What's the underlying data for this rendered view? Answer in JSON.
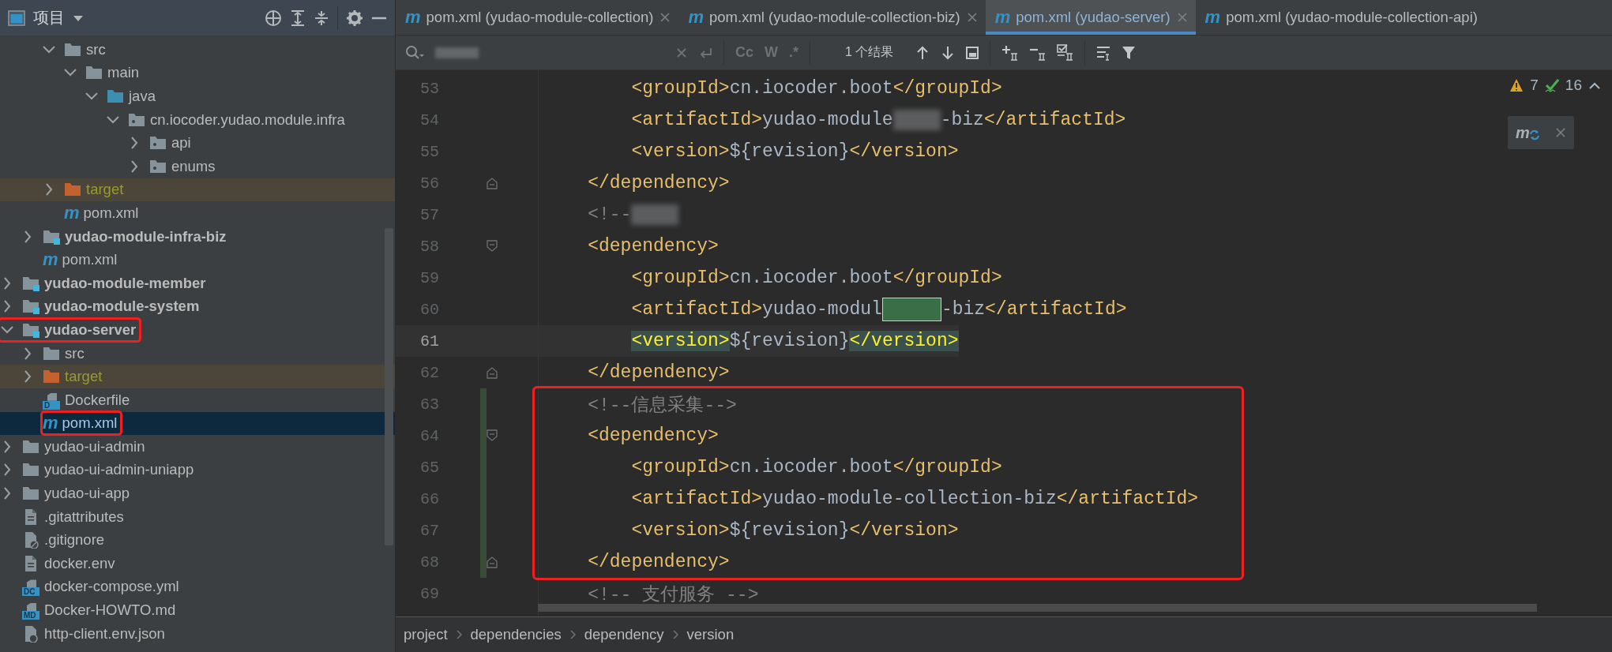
{
  "project_panel": {
    "title": "项目",
    "tree": [
      {
        "children": [
          {
            "children": [
              {
                "label": "src",
                "kind": "folder",
                "expanded": true,
                "selected": false,
                "children": [
                  {
                    "label": "main",
                    "kind": "folder",
                    "expanded": true,
                    "selected": false,
                    "children": [
                      {
                        "label": "java",
                        "kind": "source-folder",
                        "expanded": true,
                        "selected": false,
                        "children": [
                          {
                            "label": "cn.iocoder.yudao.module.infra",
                            "kind": "package",
                            "expanded": true,
                            "selected": false,
                            "children": [
                              {
                                "label": "api",
                                "kind": "package",
                                "expanded": false,
                                "selected": false
                              },
                              {
                                "label": "enums",
                                "kind": "package",
                                "expanded": false,
                                "selected": false
                              }
                            ]
                          }
                        ]
                      }
                    ]
                  }
                ]
              },
              {
                "label": "target",
                "kind": "excluded-folder",
                "expanded": false,
                "selected": false
              },
              {
                "label": "pom.xml",
                "kind": "maven",
                "badge": "m",
                "selected": false
              }
            ]
          },
          {
            "label": "yudao-module-infra-biz",
            "kind": "module",
            "expanded": false,
            "selected": false
          },
          {
            "label": "pom.xml",
            "kind": "maven",
            "badge": "m",
            "selected": false
          }
        ]
      },
      {
        "label": "yudao-module-member",
        "kind": "module",
        "expanded": false,
        "selected": false
      },
      {
        "label": "yudao-module-system",
        "kind": "module",
        "expanded": false,
        "selected": false
      },
      {
        "label": "yudao-server",
        "kind": "module",
        "expanded": true,
        "selected": false,
        "annotated": true,
        "children": [
          {
            "label": "src",
            "kind": "folder",
            "expanded": false,
            "selected": false
          },
          {
            "label": "target",
            "kind": "excluded-folder",
            "expanded": false,
            "selected": false
          },
          {
            "label": "Dockerfile",
            "kind": "badged-file",
            "badge": "D",
            "selected": false
          },
          {
            "label": "pom.xml",
            "kind": "maven",
            "badge": "m",
            "selected": true,
            "annotated": true
          }
        ]
      },
      {
        "label": "yudao-ui-admin",
        "kind": "folder",
        "expanded": false,
        "selected": false
      },
      {
        "label": "yudao-ui-admin-uniapp",
        "kind": "folder",
        "expanded": false,
        "selected": false
      },
      {
        "label": "yudao-ui-app",
        "kind": "folder",
        "expanded": false,
        "selected": false
      },
      {
        "label": ".gitattributes",
        "kind": "text-file",
        "selected": false
      },
      {
        "label": ".gitignore",
        "kind": "ignore-file",
        "selected": false
      },
      {
        "label": "docker.env",
        "kind": "text-file",
        "selected": false
      },
      {
        "label": "docker-compose.yml",
        "kind": "badged-file",
        "badge": "DC",
        "selected": false
      },
      {
        "label": "Docker-HOWTO.md",
        "kind": "badged-file",
        "badge": "MD",
        "selected": false
      },
      {
        "label": "http-client.env.json",
        "kind": "json-file",
        "selected": false
      }
    ]
  },
  "tabs": [
    {
      "badge": "m",
      "label": "pom.xml (yudao-module-collection)",
      "selected": false,
      "closable": true
    },
    {
      "badge": "m",
      "label": "pom.xml (yudao-module-collection-biz)",
      "selected": false,
      "closable": true
    },
    {
      "badge": "m",
      "label": "pom.xml (yudao-server)",
      "selected": true,
      "closable": true
    },
    {
      "badge": "m",
      "label": "pom.xml (yudao-module-collection-api)",
      "selected": false,
      "closable": false
    }
  ],
  "find_bar": {
    "options": [
      "Cc",
      "W",
      ".*"
    ],
    "result": "1 个结果"
  },
  "inspections": {
    "warnings": "7",
    "weak_warnings": "16"
  },
  "maven_popup": {
    "badge": "m"
  },
  "code_lines": [
    {
      "number": "53",
      "kind": "plain",
      "changed": false,
      "current": false,
      "annotated": false,
      "tokens": [
        {
          "kind": "tag",
          "text": "        <groupId>"
        },
        {
          "kind": "text",
          "text": "cn.iocoder.boot"
        },
        {
          "kind": "tag",
          "text": "</groupId>"
        }
      ]
    },
    {
      "number": "54",
      "kind": "plain",
      "changed": false,
      "current": false,
      "annotated": false,
      "tokens": [
        {
          "kind": "tag",
          "text": "        <artifactId>"
        },
        {
          "kind": "text",
          "text": "yudao-module"
        },
        {
          "kind": "redacted"
        },
        {
          "kind": "text",
          "text": "-biz"
        },
        {
          "kind": "tag",
          "text": "</artifactId>"
        }
      ]
    },
    {
      "number": "55",
      "kind": "plain",
      "changed": false,
      "current": false,
      "annotated": false,
      "tokens": [
        {
          "kind": "tag",
          "text": "        <version>"
        },
        {
          "kind": "text",
          "text": "${revision}"
        },
        {
          "kind": "tag",
          "text": "</version>"
        }
      ]
    },
    {
      "number": "56",
      "kind": "fold-end",
      "changed": false,
      "current": false,
      "annotated": false,
      "tokens": [
        {
          "kind": "tag",
          "text": "    </dependency>"
        }
      ]
    },
    {
      "number": "57",
      "kind": "plain",
      "changed": false,
      "current": false,
      "annotated": false,
      "tokens": [
        {
          "kind": "comment",
          "text": "    <!--"
        },
        {
          "kind": "redacted"
        }
      ]
    },
    {
      "number": "58",
      "kind": "fold-start",
      "changed": false,
      "current": false,
      "annotated": false,
      "tokens": [
        {
          "kind": "tag",
          "text": "    <dependency>"
        }
      ]
    },
    {
      "number": "59",
      "kind": "plain",
      "changed": false,
      "current": false,
      "annotated": false,
      "tokens": [
        {
          "kind": "tag",
          "text": "        <groupId>"
        },
        {
          "kind": "text",
          "text": "cn.iocoder.boot"
        },
        {
          "kind": "tag",
          "text": "</groupId>"
        }
      ]
    },
    {
      "number": "60",
      "kind": "plain",
      "changed": false,
      "current": false,
      "annotated": false,
      "tokens": [
        {
          "kind": "tag",
          "text": "        <artifactId>"
        },
        {
          "kind": "text",
          "text": "yudao-modul"
        },
        {
          "kind": "redacted-match"
        },
        {
          "kind": "text",
          "text": "-biz"
        },
        {
          "kind": "tag",
          "text": "</artifactId>"
        }
      ]
    },
    {
      "number": "61",
      "kind": "plain",
      "changed": false,
      "current": true,
      "annotated": false,
      "tokens": [
        {
          "kind": "tag-match",
          "text": "        <version>"
        },
        {
          "kind": "text",
          "text": "${revision}"
        },
        {
          "kind": "tag-match",
          "text": "</version>"
        }
      ]
    },
    {
      "number": "62",
      "kind": "fold-end",
      "changed": false,
      "current": false,
      "annotated": false,
      "tokens": [
        {
          "kind": "tag",
          "text": "    </dependency>"
        }
      ]
    },
    {
      "number": "63",
      "kind": "plain",
      "changed": true,
      "current": false,
      "annotated": true,
      "tokens": [
        {
          "kind": "comment",
          "text": "    <!--信息采集-->"
        }
      ]
    },
    {
      "number": "64",
      "kind": "fold-start",
      "changed": true,
      "current": false,
      "annotated": true,
      "tokens": [
        {
          "kind": "tag",
          "text": "    <dependency>"
        }
      ]
    },
    {
      "number": "65",
      "kind": "plain",
      "changed": true,
      "current": false,
      "annotated": true,
      "tokens": [
        {
          "kind": "tag",
          "text": "        <groupId>"
        },
        {
          "kind": "text",
          "text": "cn.iocoder.boot"
        },
        {
          "kind": "tag",
          "text": "</groupId>"
        }
      ]
    },
    {
      "number": "66",
      "kind": "plain",
      "changed": true,
      "current": false,
      "annotated": true,
      "tokens": [
        {
          "kind": "tag",
          "text": "        <artifactId>"
        },
        {
          "kind": "text",
          "text": "yudao-module-collection-biz"
        },
        {
          "kind": "tag",
          "text": "</artifactId>"
        }
      ]
    },
    {
      "number": "67",
      "kind": "plain",
      "changed": true,
      "current": false,
      "annotated": true,
      "tokens": [
        {
          "kind": "tag",
          "text": "        <version>"
        },
        {
          "kind": "text",
          "text": "${revision}"
        },
        {
          "kind": "tag",
          "text": "</version>"
        }
      ]
    },
    {
      "number": "68",
      "kind": "fold-end",
      "changed": true,
      "current": false,
      "annotated": true,
      "tokens": [
        {
          "kind": "tag",
          "text": "    </dependency>"
        }
      ]
    },
    {
      "number": "69",
      "kind": "plain",
      "changed": false,
      "current": false,
      "annotated": false,
      "tokens": [
        {
          "kind": "comment",
          "text": "    <!-- 支付服务 -->"
        }
      ]
    }
  ],
  "breadcrumbs": [
    "project",
    "dependencies",
    "dependency",
    "version"
  ]
}
